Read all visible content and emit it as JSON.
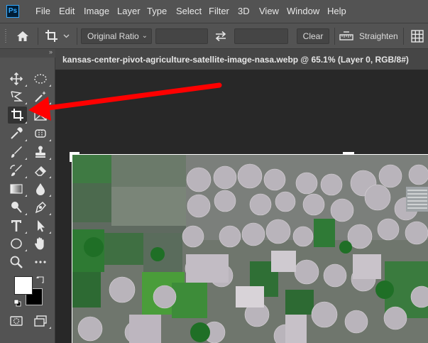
{
  "app": {
    "logo_text": "Ps"
  },
  "menu": [
    "File",
    "Edit",
    "Image",
    "Layer",
    "Type",
    "Select",
    "Filter",
    "3D",
    "View",
    "Window",
    "Help"
  ],
  "options_bar": {
    "home_icon": "home-icon",
    "crop_preset_icon": "crop-icon",
    "ratio_select": "Original Ratio",
    "width_value": "",
    "height_value": "",
    "swap_icon": "swap-arrows-icon",
    "clear_label": "Clear",
    "straighten_label": "Straighten",
    "overlay_icon": "grid-overlay-icon"
  },
  "document": {
    "title": "kansas-center-pivot-agriculture-satellite-image-nasa.webp @ 65.1% (Layer 0, RGB/8#)"
  },
  "toolbar": {
    "tools": [
      "move-tool-icon",
      "marquee-tool-icon",
      "lasso-tool-icon",
      "quick-selection-tool-icon",
      "crop-tool-icon",
      "frame-tool-icon",
      "eyedropper-tool-icon",
      "spot-healing-tool-icon",
      "brush-tool-icon",
      "clone-stamp-tool-icon",
      "history-brush-tool-icon",
      "eraser-tool-icon",
      "gradient-tool-icon",
      "blur-tool-icon",
      "dodge-tool-icon",
      "pen-tool-icon",
      "type-tool-icon",
      "path-selection-tool-icon",
      "ellipse-tool-icon",
      "hand-tool-icon",
      "zoom-tool-icon",
      "more-tools-icon"
    ],
    "active_tool": "crop-tool-icon",
    "foreground_color": "#ffffff",
    "background_color": "#000000"
  },
  "annotation": {
    "arrow_color": "#ff0000",
    "points_to": "crop-tool-icon"
  }
}
